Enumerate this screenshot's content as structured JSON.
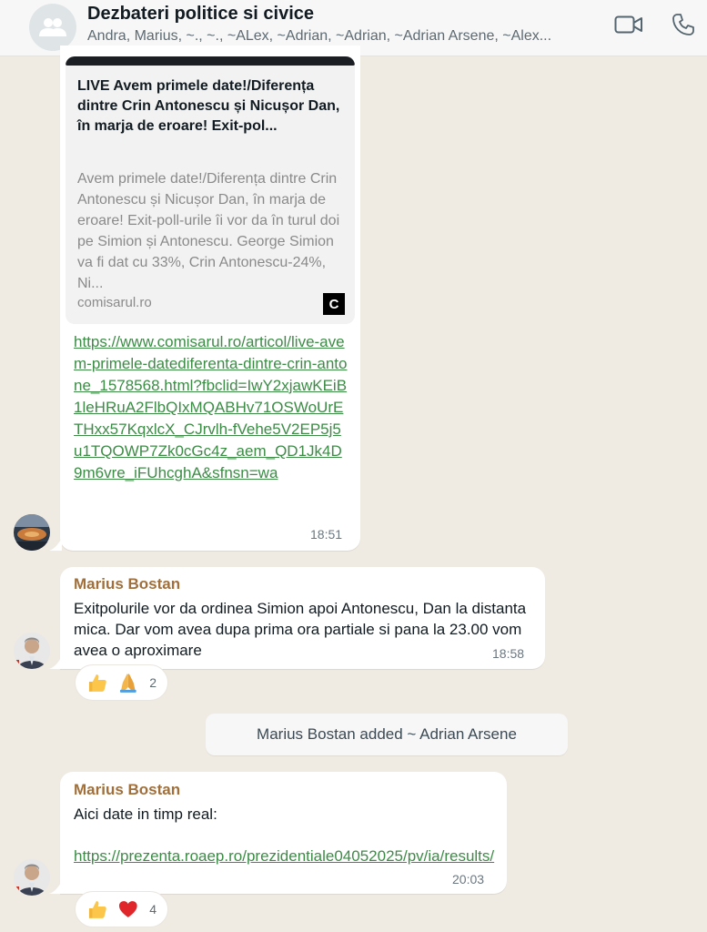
{
  "header": {
    "title": "Dezbateri politice si civice",
    "participants": "Andra, Marius, ~., ~., ~ALex, ~Adrian, ~Adrian, ~Adrian Arsene, ~Alex..."
  },
  "messages": {
    "link_preview": {
      "title": "LIVE Avem primele date!/Diferența dintre Crin Antonescu și Nicușor Dan, în marja de eroare! Exit-pol...",
      "description": "Avem primele date!/Diferența dintre Crin Antonescu și Nicușor Dan, în marja de eroare! Exit-poll-urile îi vor da în turul doi pe Simion și Antonescu. George Simion va fi dat cu 33%, Crin Antonescu-24%, Ni...",
      "domain": "comisarul.ro",
      "logo_letter": "C",
      "url": "https://www.comisarul.ro/articol/live-avem-primele-datediferenta-dintre-crin-antone_1578568.html?fbclid=IwY2xjawKEiB1leHRuA2FlbQIxMQABHv71OSWoUrETHxx57KqxlcX_CJrvlh-fVehe5V2EP5j5u1TQOWP7Zk0cGc4z_aem_QD1Jk4D9m6vre_iFUhcghA&sfnsn=wa",
      "time": "18:51"
    },
    "msg1": {
      "sender": "Marius Bostan",
      "text": "Exitpolurile vor da ordinea Simion apoi Antonescu, Dan la distanta mica. Dar vom avea dupa prima ora partiale si pana la 23.00 vom avea o aproximare",
      "time": "18:58",
      "reactions": {
        "emojis": [
          "thumbs-up",
          "folded-hands"
        ],
        "count": "2"
      }
    },
    "system": {
      "text": "Marius Bostan added ~ Adrian Arsene"
    },
    "msg2": {
      "sender": "Marius Bostan",
      "text": "Aici date in timp real:",
      "link": "https://prezenta.roaep.ro/prezidentiale04052025/pv/ia/results/",
      "time": "20:03",
      "reactions": {
        "emojis": [
          "thumbs-up",
          "red-heart"
        ],
        "count": "4"
      }
    }
  },
  "colors": {
    "chat_background": "#efeae2",
    "sender_name": "#a06f3a",
    "link": "#3c8c46",
    "bubble": "#ffffff"
  }
}
